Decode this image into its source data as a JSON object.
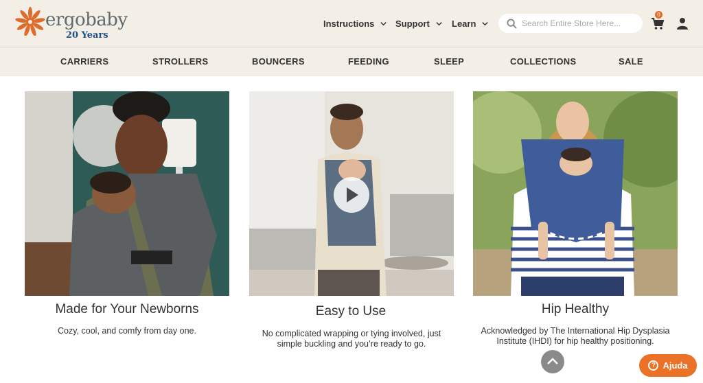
{
  "brand": {
    "name": "ergobaby",
    "tagline": "20 Years",
    "accent": "#e06c2c",
    "years_color": "#1c4f86"
  },
  "header": {
    "nav": [
      {
        "label": "Instructions"
      },
      {
        "label": "Support"
      },
      {
        "label": "Learn"
      }
    ],
    "search_placeholder": "Search Entire Store Here...",
    "cart_count": "0"
  },
  "categories": [
    "CARRIERS",
    "STROLLERS",
    "BOUNCERS",
    "FEEDING",
    "SLEEP",
    "COLLECTIONS",
    "SALE"
  ],
  "features": [
    {
      "title": "Made for Your Newborns",
      "text": "Cozy, cool, and comfy from day one."
    },
    {
      "title": "Easy to Use",
      "text_line1": "No complicated wrapping or tying involved, just",
      "text_line2": "simple buckling and you’re ready to go."
    },
    {
      "title": "Hip Healthy",
      "text_line1": "Acknowledged by The International Hip Dysplasia",
      "text_line2": "Institute (IHDI) for hip healthy positioning."
    }
  ],
  "help_button": {
    "label": "Ajuda",
    "color": "#ea7125"
  }
}
